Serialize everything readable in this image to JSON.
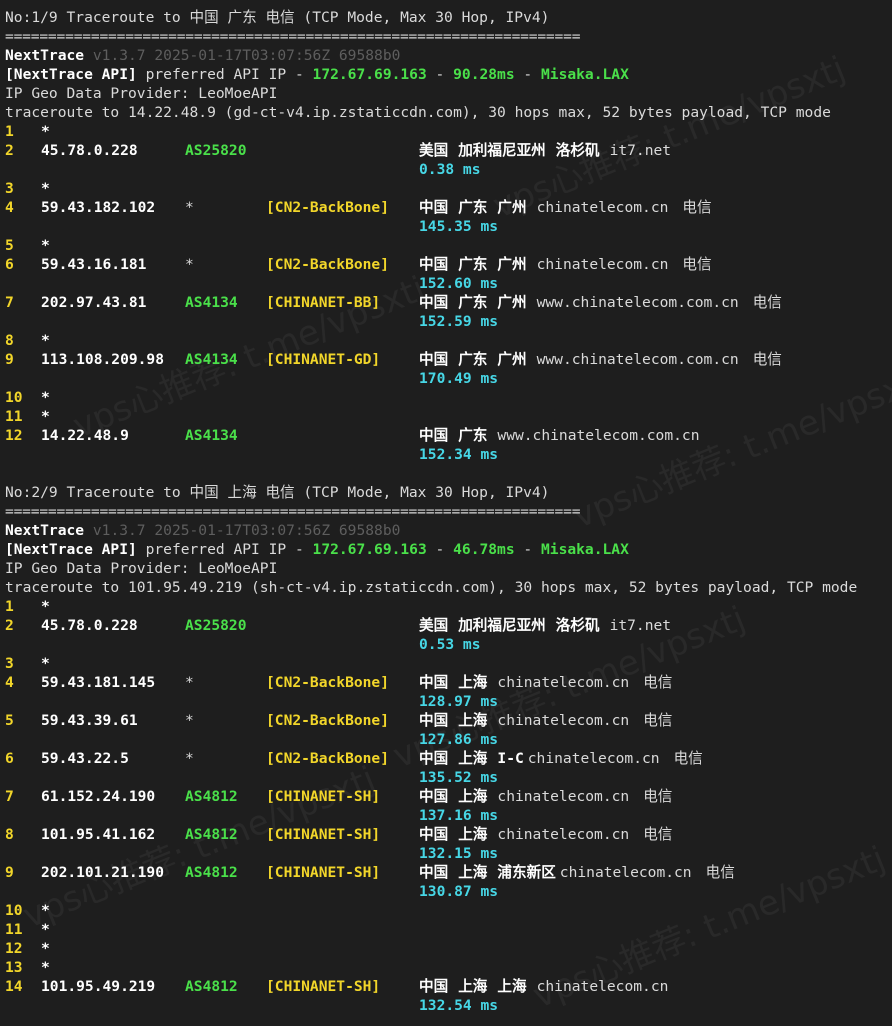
{
  "watermark": "vps心推荐: t.me/vpsxtj",
  "blocks": [
    {
      "title": "No:1/9 Traceroute to 中国 广东 电信 (TCP Mode, Max 30 Hop, IPv4)",
      "separator": "===================================================================",
      "brand": "NextTrace",
      "version": "v1.3.7 2025-01-17T03:07:56Z 69588b0",
      "api_label": "[NextTrace API]",
      "api_text": " preferred API IP - ",
      "api_ip": "172.67.69.163",
      "api_dash": " - ",
      "api_rtt": "90.28ms",
      "api_node": "Misaka.LAX",
      "geo_provider": "IP Geo Data Provider: LeoMoeAPI",
      "traceroute_line": "traceroute to 14.22.48.9 (gd-ct-v4.ip.zstaticcdn.com), 30 hops max, 52 bytes payload, TCP mode",
      "hops": [
        {
          "n": "1",
          "star": "*"
        },
        {
          "n": "2",
          "ip": "45.78.0.228",
          "asn": "AS25820",
          "country": "美国",
          "region": "加利福尼亚州",
          "city": "洛杉矶",
          "domain": "it7.net",
          "rtt": "0.38 ms"
        },
        {
          "n": "3",
          "star": "*"
        },
        {
          "n": "4",
          "ip": "59.43.182.102",
          "asn": "*",
          "tag": "[CN2-BackBone]",
          "country": "中国",
          "region": "广东",
          "city": "广州",
          "domain": "chinatelecom.cn",
          "isp": "电信",
          "rtt": "145.35 ms"
        },
        {
          "n": "5",
          "star": "*"
        },
        {
          "n": "6",
          "ip": "59.43.16.181",
          "asn": "*",
          "tag": "[CN2-BackBone]",
          "country": "中国",
          "region": "广东",
          "city": "广州",
          "domain": "chinatelecom.cn",
          "isp": "电信",
          "rtt": "152.60 ms"
        },
        {
          "n": "7",
          "ip": "202.97.43.81",
          "asn": "AS4134",
          "tag": "[CHINANET-BB]",
          "country": "中国",
          "region": "广东",
          "city": "广州",
          "domain": "www.chinatelecom.com.cn",
          "isp": "电信",
          "rtt": "152.59 ms"
        },
        {
          "n": "8",
          "star": "*"
        },
        {
          "n": "9",
          "ip": "113.108.209.98",
          "asn": "AS4134",
          "tag": "[CHINANET-GD]",
          "country": "中国",
          "region": "广东",
          "city": "广州",
          "domain": "www.chinatelecom.com.cn",
          "isp": "电信",
          "rtt": "170.49 ms"
        },
        {
          "n": "10",
          "star": "*"
        },
        {
          "n": "11",
          "star": "*"
        },
        {
          "n": "12",
          "ip": "14.22.48.9",
          "asn": "AS4134",
          "country": "中国",
          "region": "广东",
          "domain": "www.chinatelecom.com.cn",
          "rtt": "152.34 ms"
        }
      ]
    },
    {
      "title": "No:2/9 Traceroute to 中国 上海 电信 (TCP Mode, Max 30 Hop, IPv4)",
      "separator": "===================================================================",
      "brand": "NextTrace",
      "version": "v1.3.7 2025-01-17T03:07:56Z 69588b0",
      "api_label": "[NextTrace API]",
      "api_text": " preferred API IP - ",
      "api_ip": "172.67.69.163",
      "api_dash": " - ",
      "api_rtt": "46.78ms",
      "api_node": "Misaka.LAX",
      "geo_provider": "IP Geo Data Provider: LeoMoeAPI",
      "traceroute_line": "traceroute to 101.95.49.219 (sh-ct-v4.ip.zstaticcdn.com), 30 hops max, 52 bytes payload, TCP mode",
      "hops": [
        {
          "n": "1",
          "star": "*"
        },
        {
          "n": "2",
          "ip": "45.78.0.228",
          "asn": "AS25820",
          "country": "美国",
          "region": "加利福尼亚州",
          "city": "洛杉矶",
          "domain": "it7.net",
          "rtt": "0.53 ms"
        },
        {
          "n": "3",
          "star": "*"
        },
        {
          "n": "4",
          "ip": "59.43.181.145",
          "asn": "*",
          "tag": "[CN2-BackBone]",
          "country": "中国",
          "region": "上海",
          "domain": "chinatelecom.cn",
          "isp": "电信",
          "rtt": "128.97 ms"
        },
        {
          "n": "5",
          "ip": "59.43.39.61",
          "asn": "*",
          "tag": "[CN2-BackBone]",
          "country": "中国",
          "region": "上海",
          "domain": "chinatelecom.cn",
          "isp": "电信",
          "rtt": "127.86 ms"
        },
        {
          "n": "6",
          "ip": "59.43.22.5",
          "asn": "*",
          "tag": "[CN2-BackBone]",
          "country": "中国",
          "region": "上海",
          "district": "I-C",
          "domain": "chinatelecom.cn",
          "isp": "电信",
          "rtt": "135.52 ms"
        },
        {
          "n": "7",
          "ip": "61.152.24.190",
          "asn": "AS4812",
          "tag": "[CHINANET-SH]",
          "country": "中国",
          "region": "上海",
          "domain": "chinatelecom.cn",
          "isp": "电信",
          "rtt": "137.16 ms"
        },
        {
          "n": "8",
          "ip": "101.95.41.162",
          "asn": "AS4812",
          "tag": "[CHINANET-SH]",
          "country": "中国",
          "region": "上海",
          "domain": "chinatelecom.cn",
          "isp": "电信",
          "rtt": "132.15 ms"
        },
        {
          "n": "9",
          "ip": "202.101.21.190",
          "asn": "AS4812",
          "tag": "[CHINANET-SH]",
          "country": "中国",
          "region": "上海",
          "district": "浦东新区",
          "domain": "chinatelecom.cn",
          "isp": "电信",
          "rtt": "130.87 ms"
        },
        {
          "n": "10",
          "star": "*"
        },
        {
          "n": "11",
          "star": "*"
        },
        {
          "n": "12",
          "star": "*"
        },
        {
          "n": "13",
          "star": "*"
        },
        {
          "n": "14",
          "ip": "101.95.49.219",
          "asn": "AS4812",
          "tag": "[CHINANET-SH]",
          "country": "中国",
          "region": "上海",
          "city": "上海",
          "domain": "chinatelecom.cn",
          "rtt": "132.54 ms"
        }
      ]
    }
  ]
}
